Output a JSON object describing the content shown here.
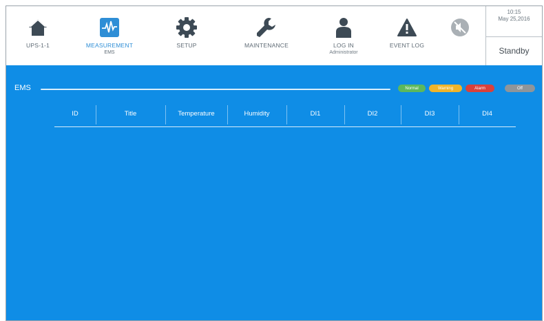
{
  "nav": [
    {
      "label": "UPS-1-1",
      "sub": "",
      "icon": "home-icon"
    },
    {
      "label": "MEASUREMENT",
      "sub": "EMS",
      "icon": "measurement-icon"
    },
    {
      "label": "SETUP",
      "sub": "",
      "icon": "gear-icon"
    },
    {
      "label": "MAINTENANCE",
      "sub": "",
      "icon": "wrench-icon"
    },
    {
      "label": "LOG IN",
      "sub": "Administrator",
      "icon": "user-icon"
    },
    {
      "label": "EVENT LOG",
      "sub": "",
      "icon": "warning-icon"
    }
  ],
  "mute_icon": "mute-icon",
  "clock": {
    "time": "10:15",
    "date": "May 25,2016"
  },
  "status": "Standby",
  "section_title": "EMS",
  "legend": [
    {
      "label": "Normal",
      "color": "#5cb85c"
    },
    {
      "label": "Warning",
      "color": "#f0b429"
    },
    {
      "label": "Alarm",
      "color": "#d9413b"
    },
    {
      "label": "Off",
      "color": "#8f959a"
    }
  ],
  "table": {
    "headers": [
      "ID",
      "Title",
      "Temperature",
      "Humidity",
      "DI1",
      "DI2",
      "DI3",
      "DI4"
    ],
    "rows": []
  },
  "colors": {
    "accent": "#2e8ed6",
    "panel": "#0f8de6",
    "icon": "#3d4a55"
  }
}
